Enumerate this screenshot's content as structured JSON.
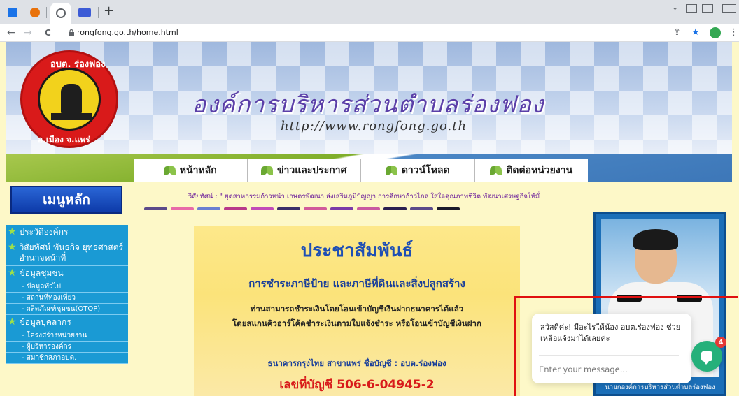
{
  "browser": {
    "url": "rongfong.go.th/home.html",
    "new_tab_symbol": "+",
    "back_symbol": "←",
    "forward_symbol": "→",
    "reload_symbol": "C",
    "share_symbol": "⇪",
    "star_symbol": "★",
    "menu_symbol": "⋮",
    "minimize_symbol": "⌄",
    "tab_colors": [
      "#1a73e8",
      "#e8710a",
      "#5f6368",
      "#3c5bd6"
    ]
  },
  "banner": {
    "title": "องค์การบริหารส่วนตำบลร่องฟอง",
    "website": "http://www.rongfong.go.th",
    "seal_top": "อบต. ร่องฟอง",
    "seal_bottom": "อ.เมือง จ.แพร่"
  },
  "nav": {
    "items": [
      {
        "label": "หน้าหลัก"
      },
      {
        "label": "ข่าวและประกาศ"
      },
      {
        "label": "ดาวน์โหลด"
      },
      {
        "label": "ติดต่อหน่วยงาน"
      }
    ]
  },
  "sidebar": {
    "menu_title": "เมนูหลัก",
    "main_items": {
      "history": "ประวัติองค์กร",
      "vision": "วิสัยทัศน์ พันธกิจ ยุทธศาสตร์ อำนาจหน้าที่",
      "community": "ข้อมูลชุมชน",
      "personnel": "ข้อมูลบุคลากร"
    },
    "community_subs": [
      "- ข้อมูลทั่วไป",
      "- สถานที่ท่องเที่ยว",
      "- ผลิตภัณฑ์ชุมชน(OTOP)"
    ],
    "personnel_subs": [
      "- โครงสร้างหน่วยงาน",
      "- ผู้บริหารองค์กร",
      "- สมาชิกสภาอบต."
    ]
  },
  "vision_text": "วิสัยทัศน์ : \" ยุตสาหกรรมก้าวหน้า เกษตรพัฒนา ส่งเสริมภูมิปัญญา การศึกษาก้าวไกล ใส่ใจคุณภาพชีวิต พัฒนาเศรษฐกิจให้มั่",
  "swatch_colors": [
    "#5b4a8a",
    "#e86aa8",
    "#6a7fd1",
    "#b83a8a",
    "#c24bb8",
    "#3a2f6a",
    "#d15a9a",
    "#7a3aa8",
    "#c85aa0",
    "#2a2050",
    "#5a4a8a",
    "#1a1a2a"
  ],
  "promo": {
    "title": "ประชาสัมพันธ์",
    "subtitle": "การชำระภาษีป้าย และภาษีที่ดินและสิ่งปลูกสร้าง",
    "line1": "ท่านสามารถชำระเงินโดยโอนเข้าบัญชีเงินฝากธนาคารได้แล้ว",
    "line2": "โดยสแกนคิวอาร์โค้ดชำระเงินตามใบแจ้งชำระ หรือโอนเข้าบัญชีเงินฝาก",
    "bank": "ธนาคารกรุงไทย สาขาแพร่ ชื่อบัญชี : อบต.ร่องฟอง",
    "account": "เลขที่บัญชี 506-6-04945-2"
  },
  "portrait": {
    "caption": "นายกองค์การบริหารส่วนตำบลร่องฟอง"
  },
  "chat": {
    "message": "สวัสดีค่ะ! มีอะไรให้น้อง อบต.ร่องฟอง ช่วยเหลือแจ้งมาได้เลยค่ะ",
    "placeholder": "Enter your message...",
    "badge_count": "4",
    "accent": "#25b07a"
  }
}
